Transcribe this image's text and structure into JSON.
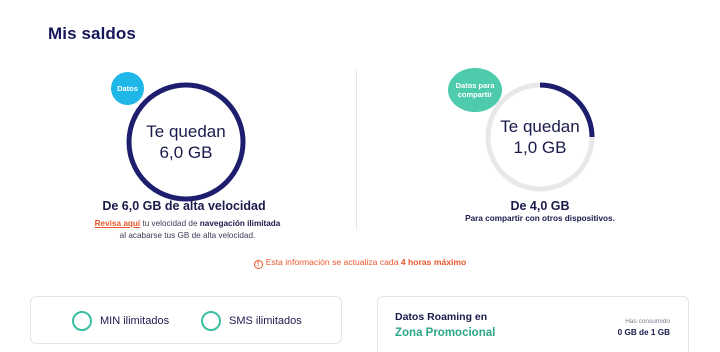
{
  "page": {
    "title": "Mis saldos"
  },
  "balances": [
    {
      "badge": "Datos",
      "badge_color": "#1fb6e8",
      "remaining_line1": "Te quedan",
      "remaining_line2": "6,0 GB",
      "ring_color": "#1d1f6e",
      "used_fraction": 0.0,
      "caption": "De 6,0 GB de alta velocidad",
      "note_link": "Revisa aquí",
      "note_part1": " tu velocidad de ",
      "note_strong": "navegación ilimitada",
      "note_part2": "al acabarse tus GB de alta velocidad."
    },
    {
      "badge": "Datos para compartir",
      "badge_color": "#4ecbad",
      "remaining_line1": "Te quedan",
      "remaining_line2": "1,0 GB",
      "ring_color": "#1d1f6e",
      "track_color": "#e8e8ea",
      "remaining_fraction": 0.25,
      "caption": "De 4,0 GB",
      "note": "Para compartir con otros dispositivos."
    }
  ],
  "info": {
    "text_before": "Esta información se actualiza cada ",
    "text_emph": "4 horas máximo",
    "icon": "info-icon"
  },
  "unlimited": {
    "items": [
      {
        "label": "MIN ilimitados",
        "icon": "ring-icon"
      },
      {
        "label": "SMS ilimitados",
        "icon": "ring-icon"
      }
    ]
  },
  "roaming": {
    "title": "Datos Roaming en",
    "subtitle": "Zona Promocional",
    "consumed_label": "Has consumido",
    "consumed_value": "0 GB de 1 GB"
  }
}
